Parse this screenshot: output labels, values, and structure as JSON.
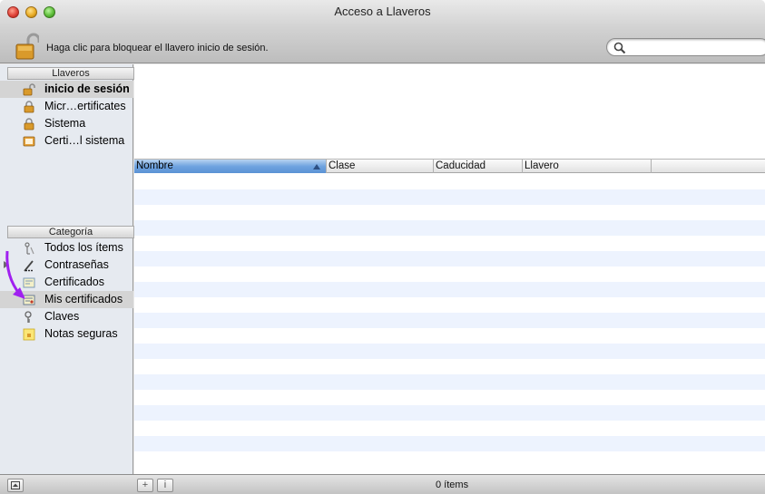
{
  "window": {
    "title": "Acceso a Llaveros"
  },
  "toolbar": {
    "lock_message": "Haga clic para bloquear el llavero inicio de sesión.",
    "search_placeholder": ""
  },
  "sidebar": {
    "keychains_header": "Llaveros",
    "keychains": [
      {
        "label": "inicio de sesión",
        "icon": "unlocked-padlock-icon",
        "selected": true
      },
      {
        "label": "Micr…ertificates",
        "icon": "padlock-icon"
      },
      {
        "label": "Sistema",
        "icon": "padlock-icon"
      },
      {
        "label": "Certi…l sistema",
        "icon": "certificate-folder-icon"
      }
    ],
    "category_header": "Categoría",
    "categories": [
      {
        "label": "Todos los ítems",
        "icon": "all-items-icon"
      },
      {
        "label": "Contraseñas",
        "icon": "password-pen-icon",
        "expandable": true
      },
      {
        "label": "Certificados",
        "icon": "certificate-icon"
      },
      {
        "label": "Mis certificados",
        "icon": "my-certificate-icon",
        "selected": true
      },
      {
        "label": "Claves",
        "icon": "key-icon"
      },
      {
        "label": "Notas seguras",
        "icon": "secure-note-icon"
      }
    ]
  },
  "table": {
    "columns": [
      "Nombre",
      "Clase",
      "Caducidad",
      "Llavero"
    ],
    "sorted_column": "Nombre",
    "rows": []
  },
  "bottombar": {
    "status": "0 ítems",
    "add_label": "+",
    "info_label": "i"
  },
  "colors": {
    "selection": "#d4d4d4",
    "row_alt": "#edf3fe",
    "header_active": "#6fa3e0",
    "annotation_arrow": "#a020f0"
  }
}
